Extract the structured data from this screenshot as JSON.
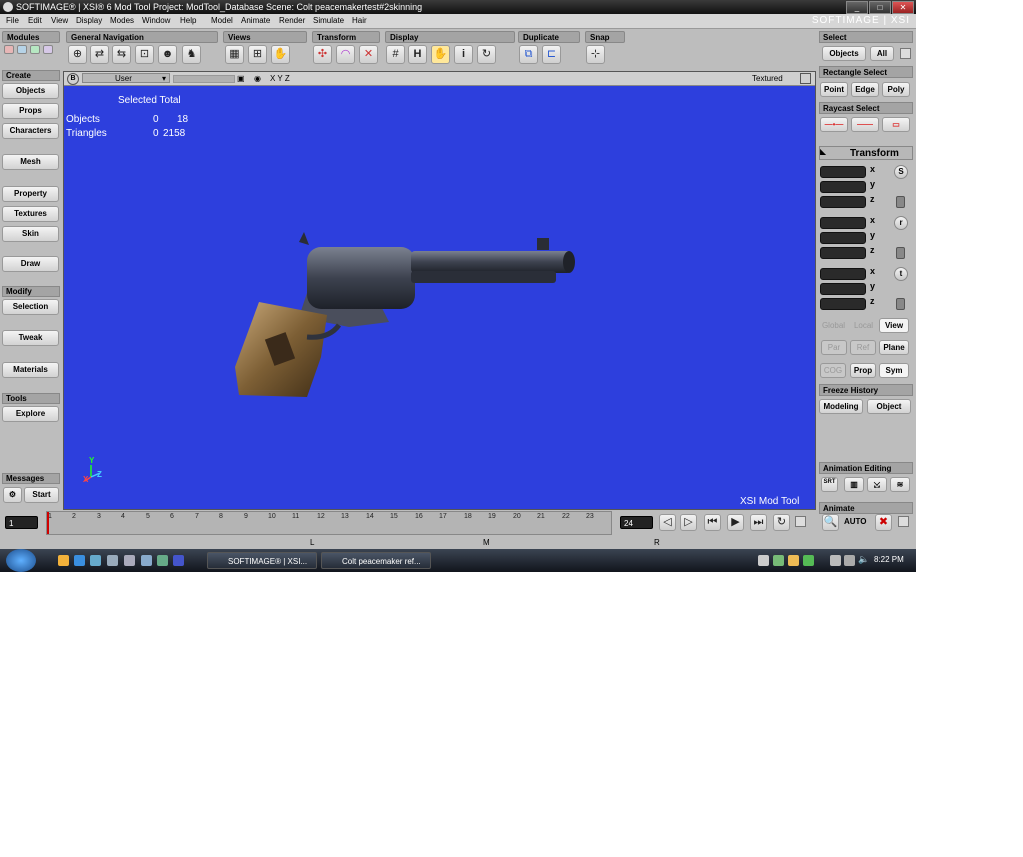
{
  "window": {
    "title": "SOFTIMAGE® | XSI® 6 Mod Tool Project: ModTool_Database    Scene: Colt peacemakertest#2skinning",
    "brand": "SOFTIMAGE | XSI"
  },
  "menu": [
    "File",
    "Edit",
    "View",
    "Display",
    "Modes",
    "Window",
    "Help",
    "Model",
    "Animate",
    "Render",
    "Simulate",
    "Hair"
  ],
  "toolbar": {
    "modules": "Modules",
    "general_navigation": "General Navigation",
    "views": "Views",
    "transform": "Transform",
    "display": "Display",
    "duplicate": "Duplicate",
    "snap": "Snap",
    "h_label": "H",
    "i_label": "i"
  },
  "left_panel": {
    "create": "Create",
    "objects": "Objects",
    "props": "Props",
    "characters": "Characters",
    "mesh": "Mesh",
    "property": "Property",
    "textures": "Textures",
    "skin": "Skin",
    "draw": "Draw",
    "modify": "Modify",
    "selection": "Selection",
    "tweak": "Tweak",
    "materials": "Materials",
    "tools": "Tools",
    "explore": "Explore",
    "messages": "Messages",
    "start": "Start"
  },
  "viewport": {
    "letter": "B",
    "camera": "User",
    "xyz": "X Y Z",
    "mode": "Textured",
    "stats_header": "Selected Total",
    "stats": [
      {
        "label": "Objects",
        "selected": "0",
        "total": "18"
      },
      {
        "label": "Triangles",
        "selected": "0",
        "total": "2158"
      }
    ],
    "watermark": "XSI Mod Tool",
    "axis_x": "X",
    "axis_y": "Y",
    "axis_z": "Z"
  },
  "right_panel": {
    "select": "Select",
    "objects": "Objects",
    "all": "All",
    "rect_select": "Rectangle Select",
    "point": "Point",
    "edge": "Edge",
    "poly": "Poly",
    "raycast_select": "Raycast Select",
    "transform": "Transform",
    "axes": [
      "x",
      "y",
      "z"
    ],
    "scale_btn": "S",
    "rot_btn": "r",
    "trans_btn": "t",
    "global": "Global",
    "local": "Local",
    "view": "View",
    "par": "Par",
    "ref": "Ref",
    "plane": "Plane",
    "cog": "COG",
    "prop": "Prop",
    "sym": "Sym",
    "freeze_history": "Freeze History",
    "modeling": "Modeling",
    "object": "Object",
    "animation_editing": "Animation Editing",
    "srt": "SRT",
    "animate": "Animate",
    "auto": "AUTO"
  },
  "timeline": {
    "current_frame": "1",
    "end_frame": "24",
    "ticks": [
      "1",
      "2",
      "3",
      "4",
      "5",
      "6",
      "7",
      "8",
      "9",
      "10",
      "11",
      "12",
      "13",
      "14",
      "15",
      "16",
      "17",
      "18",
      "19",
      "20",
      "21",
      "22",
      "23"
    ],
    "markers": [
      "L",
      "M",
      "R"
    ]
  },
  "taskbar": {
    "apps": [
      "SOFTIMAGE® | XSI...",
      "Colt peacemaker ref..."
    ],
    "clock": "8:22 PM"
  },
  "colors": {
    "viewport_bg": "#2d3fdd",
    "panel_bg": "#bdbdbd",
    "section_header": "#a4a4a4",
    "timeline_marker": "#d00000"
  }
}
